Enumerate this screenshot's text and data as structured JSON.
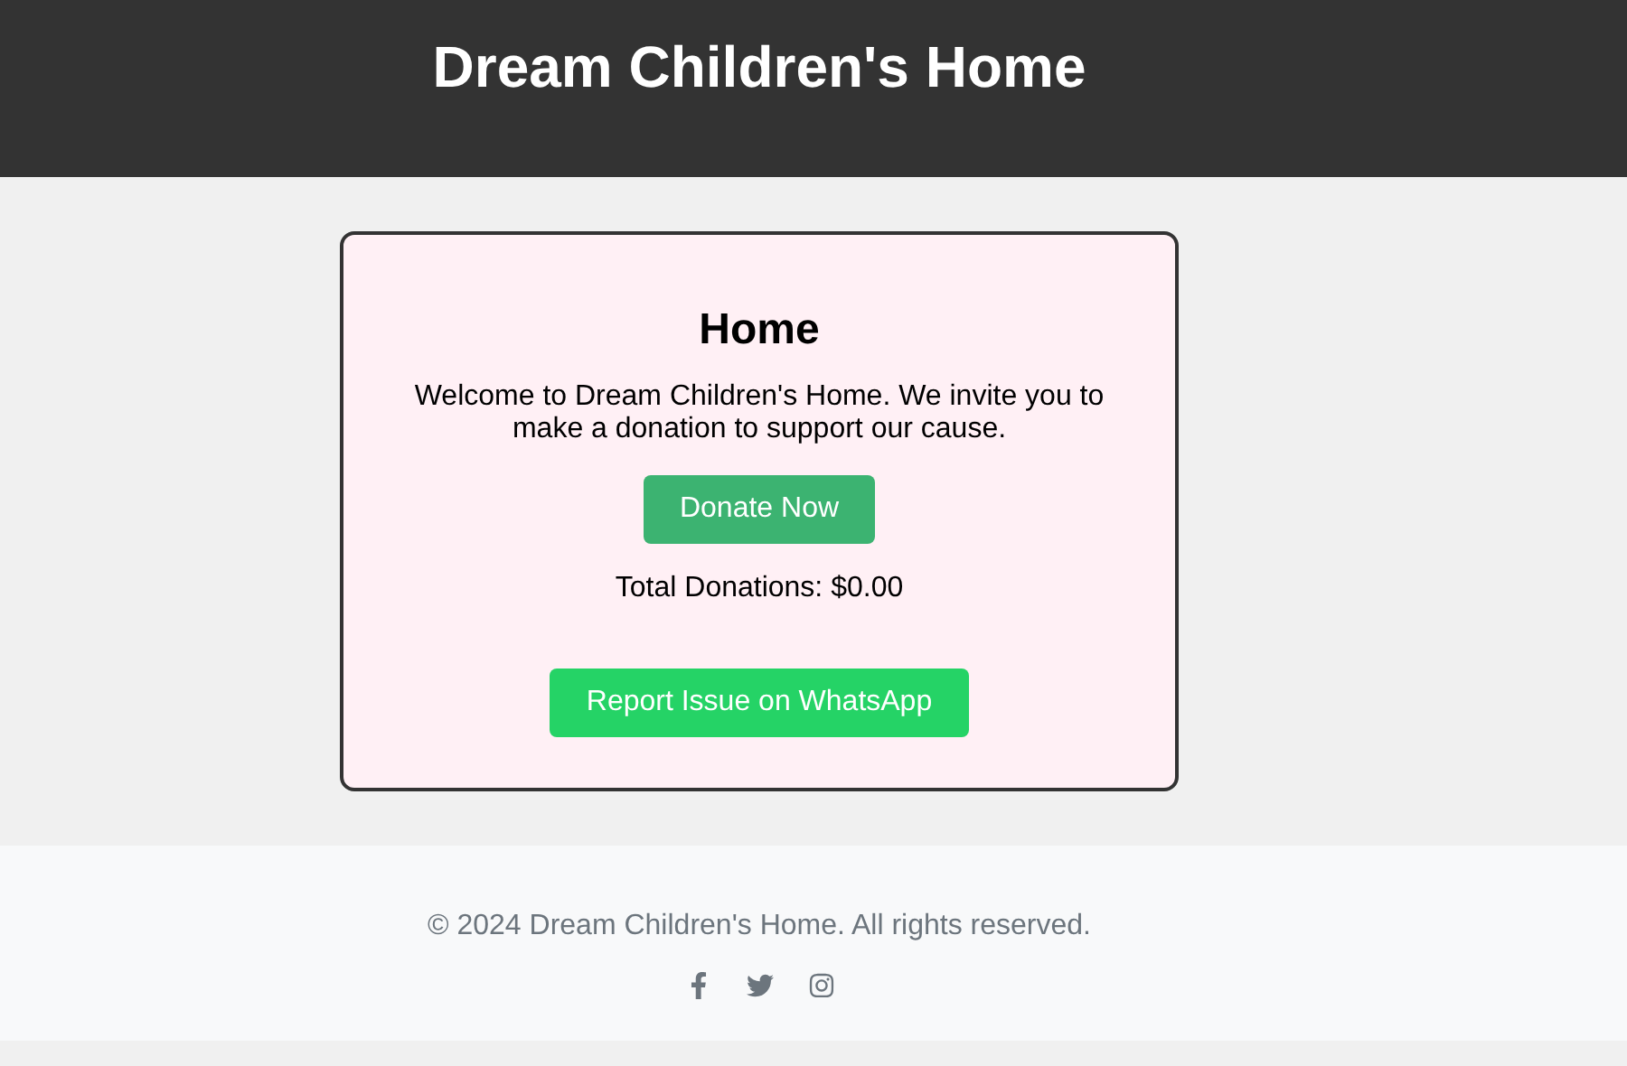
{
  "header": {
    "title": "Dream Children's Home"
  },
  "card": {
    "heading": "Home",
    "intro": "Welcome to Dream Children's Home. We invite you to make a donation to support our cause.",
    "donate_button": "Donate Now",
    "total": "Total Donations: $0.00",
    "report_button": "Report Issue on WhatsApp"
  },
  "footer": {
    "copyright": "© 2024 Dream Children's Home. All rights reserved.",
    "social_links": [
      {
        "kind": "facebook"
      },
      {
        "kind": "twitter"
      },
      {
        "kind": "instagram"
      }
    ]
  }
}
